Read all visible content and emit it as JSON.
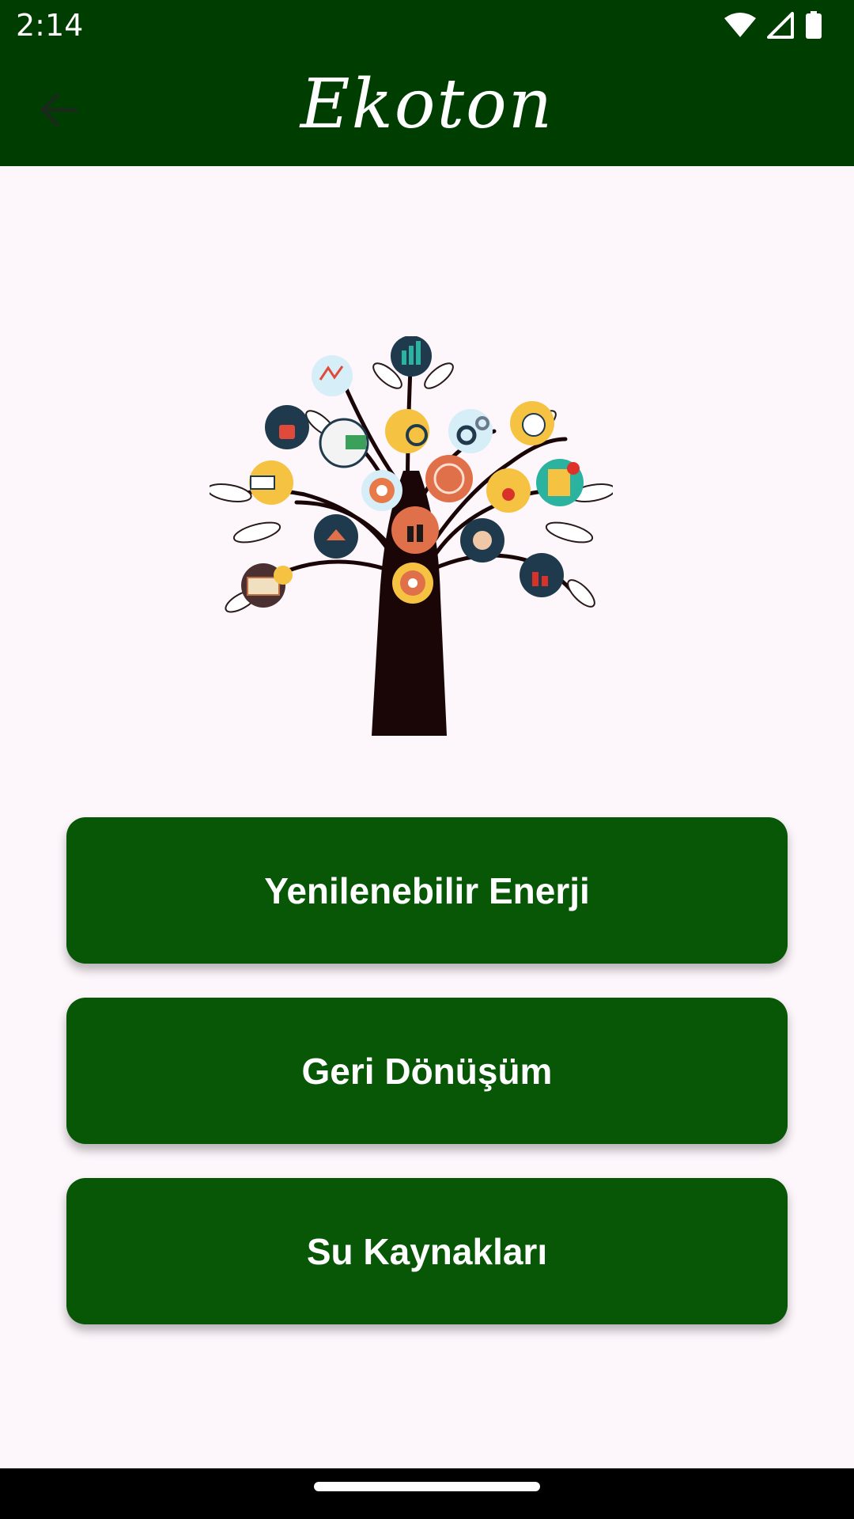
{
  "status_bar": {
    "time": "2:14",
    "icons": [
      "wifi-icon",
      "signal-icon",
      "battery-icon"
    ]
  },
  "app_bar": {
    "title": "Ekoton",
    "back_icon": "arrow-left-icon",
    "background": "#003d00"
  },
  "hero": {
    "image": "tree-of-business-icons-illustration"
  },
  "menu": {
    "buttons": [
      {
        "label": "Yenilenebilir Enerji"
      },
      {
        "label": "Geri Dönüşüm"
      },
      {
        "label": "Su Kaynakları"
      }
    ],
    "button_color": "#075707"
  }
}
